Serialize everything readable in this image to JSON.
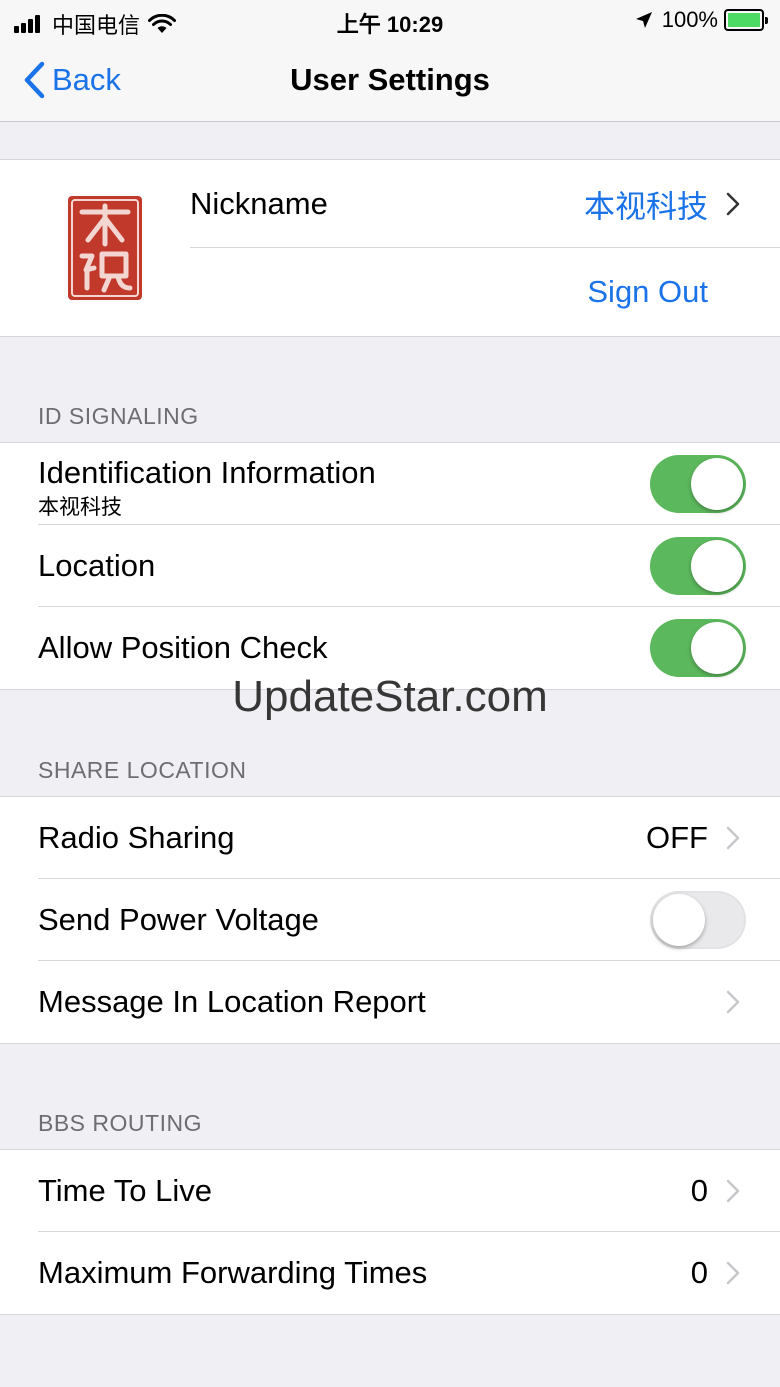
{
  "status_bar": {
    "carrier": "中国电信",
    "time": "上午 10:29",
    "battery": "100%"
  },
  "nav": {
    "back_label": "Back",
    "title": "User Settings"
  },
  "profile": {
    "nickname_label": "Nickname",
    "nickname_value": "本视科技",
    "sign_out_label": "Sign Out"
  },
  "sections": {
    "id_signaling": {
      "header": "ID SIGNALING",
      "identification_label": "Identification Information",
      "identification_sub": "本视科技",
      "identification_on": true,
      "location_label": "Location",
      "location_on": true,
      "position_check_label": "Allow Position Check",
      "position_check_on": true
    },
    "share_location": {
      "header": "SHARE LOCATION",
      "radio_sharing_label": "Radio Sharing",
      "radio_sharing_value": "OFF",
      "send_power_label": "Send Power Voltage",
      "send_power_on": false,
      "message_label": "Message In Location Report"
    },
    "bbs_routing": {
      "header": "BBS ROUTING",
      "ttl_label": "Time To Live",
      "ttl_value": "0",
      "max_fwd_label": "Maximum Forwarding Times",
      "max_fwd_value": "0"
    }
  },
  "watermark": "UpdateStar.com",
  "colors": {
    "accent": "#1a73e8",
    "toggle_on": "#5cb85c",
    "background": "#efeff4"
  }
}
